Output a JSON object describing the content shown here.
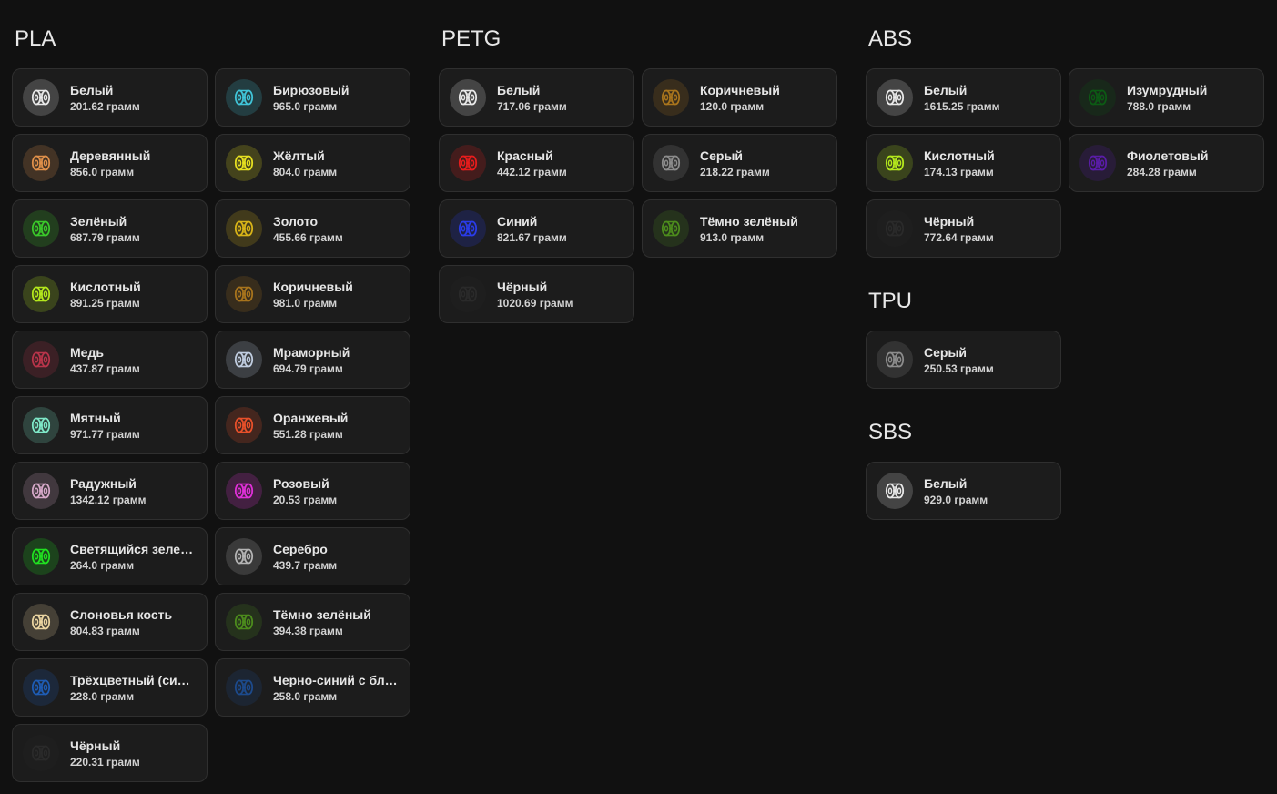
{
  "icon": "filament-spool-icon",
  "groups": [
    {
      "id": "pla",
      "title": "PLA",
      "items": [
        {
          "name": "Белый",
          "weight": "201.62 грамм",
          "color": "#e8e8e8"
        },
        {
          "name": "Бирюзовый",
          "weight": "965.0 грамм",
          "color": "#40c4d8"
        },
        {
          "name": "Деревянный",
          "weight": "856.0 грамм",
          "color": "#e0904a"
        },
        {
          "name": "Жёлтый",
          "weight": "804.0 грамм",
          "color": "#e6e020"
        },
        {
          "name": "Зелёный",
          "weight": "687.79 грамм",
          "color": "#3ac82a"
        },
        {
          "name": "Золото",
          "weight": "455.66 грамм",
          "color": "#d8b418"
        },
        {
          "name": "Кислотный",
          "weight": "891.25 грамм",
          "color": "#b4e81c"
        },
        {
          "name": "Коричневый",
          "weight": "981.0 грамм",
          "color": "#a8741c"
        },
        {
          "name": "Медь",
          "weight": "437.87 грамм",
          "color": "#b8344a"
        },
        {
          "name": "Мраморный",
          "weight": "694.79 грамм",
          "color": "#c0cde0"
        },
        {
          "name": "Мятный",
          "weight": "971.77 грамм",
          "color": "#7ee8c8"
        },
        {
          "name": "Оранжевый",
          "weight": "551.28 грамм",
          "color": "#e8502a"
        },
        {
          "name": "Радужный",
          "weight": "1342.12 грамм",
          "color": "#d6a8c8"
        },
        {
          "name": "Розовый",
          "weight": "20.53 грамм",
          "color": "#e030d8"
        },
        {
          "name": "Светящийся зеленый",
          "weight": "264.0 грамм",
          "color": "#20e020"
        },
        {
          "name": "Серебро",
          "weight": "439.7 грамм",
          "color": "#b4b4b4"
        },
        {
          "name": "Слоновья кость",
          "weight": "804.83 грамм",
          "color": "#ead4a0"
        },
        {
          "name": "Тёмно зелёный",
          "weight": "394.38 грамм",
          "color": "#4c8c1c"
        },
        {
          "name": "Трёхцветный (синий)",
          "weight": "228.0 грамм",
          "color": "#1e5cb4"
        },
        {
          "name": "Черно-синий с блёстками",
          "weight": "258.0 грамм",
          "color": "#1c4a8c"
        },
        {
          "name": "Чёрный",
          "weight": "220.31 грамм",
          "color": "#2a2a2a"
        }
      ]
    },
    {
      "id": "petg",
      "title": "PETG",
      "items": [
        {
          "name": "Белый",
          "weight": "717.06 грамм",
          "color": "#e8e8e8"
        },
        {
          "name": "Коричневый",
          "weight": "120.0 грамм",
          "color": "#a8741c"
        },
        {
          "name": "Красный",
          "weight": "442.12 грамм",
          "color": "#e81c1c"
        },
        {
          "name": "Серый",
          "weight": "218.22 грамм",
          "color": "#8c8c8c"
        },
        {
          "name": "Синий",
          "weight": "821.67 грамм",
          "color": "#2a3ce8"
        },
        {
          "name": "Тёмно зелёный",
          "weight": "913.0 грамм",
          "color": "#4c8c1c"
        },
        {
          "name": "Чёрный",
          "weight": "1020.69 грамм",
          "color": "#2a2a2a"
        }
      ]
    },
    {
      "id": "abs",
      "title": "ABS",
      "items": [
        {
          "name": "Белый",
          "weight": "1615.25 грамм",
          "color": "#e8e8e8"
        },
        {
          "name": "Изумрудный",
          "weight": "788.0 грамм",
          "color": "#0c5a14"
        },
        {
          "name": "Кислотный",
          "weight": "174.13 грамм",
          "color": "#b4e81c"
        },
        {
          "name": "Фиолетовый",
          "weight": "284.28 грамм",
          "color": "#5a1ca8"
        },
        {
          "name": "Чёрный",
          "weight": "772.64 грамм",
          "color": "#2a2a2a"
        }
      ]
    },
    {
      "id": "tpu",
      "title": "TPU",
      "items": [
        {
          "name": "Серый",
          "weight": "250.53 грамм",
          "color": "#8c8c8c"
        }
      ]
    },
    {
      "id": "sbs",
      "title": "SBS",
      "items": [
        {
          "name": "Белый",
          "weight": "929.0 грамм",
          "color": "#e8e8e8"
        }
      ]
    }
  ]
}
